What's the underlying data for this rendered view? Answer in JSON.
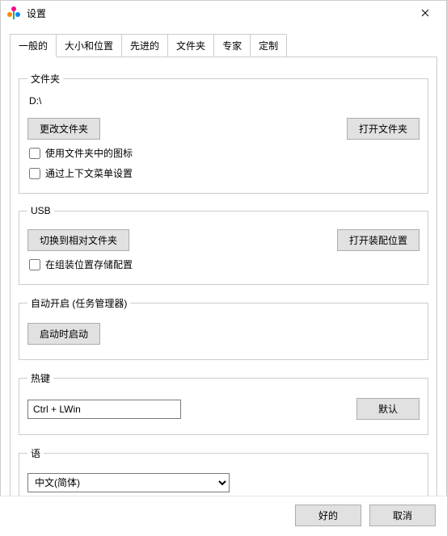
{
  "window": {
    "title": "设置"
  },
  "tabs": [
    {
      "label": "一般的"
    },
    {
      "label": "大小和位置"
    },
    {
      "label": "先进的"
    },
    {
      "label": "文件夹"
    },
    {
      "label": "专家"
    },
    {
      "label": "定制"
    }
  ],
  "general": {
    "folder_group": {
      "legend": "文件夹",
      "path": "D:\\",
      "change_folder_btn": "更改文件夹",
      "open_folder_btn": "打开文件夹",
      "use_folder_icons": "使用文件夹中的图标",
      "via_context_menu": "通过上下文菜单设置"
    },
    "usb_group": {
      "legend": "USB",
      "switch_relative_btn": "切换到相对文件夹",
      "open_install_btn": "打开装配位置",
      "store_at_install": "在组装位置存储配置"
    },
    "autostart_group": {
      "legend": "自动开启 (任务管理器)",
      "start_on_boot_btn": "启动时启动"
    },
    "hotkey_group": {
      "legend": "热键",
      "value": "Ctrl + LWin",
      "default_btn": "默认"
    },
    "language_group": {
      "legend": "语",
      "selected": "中文(简体)"
    }
  },
  "footer": {
    "ok": "好的",
    "cancel": "取消"
  }
}
